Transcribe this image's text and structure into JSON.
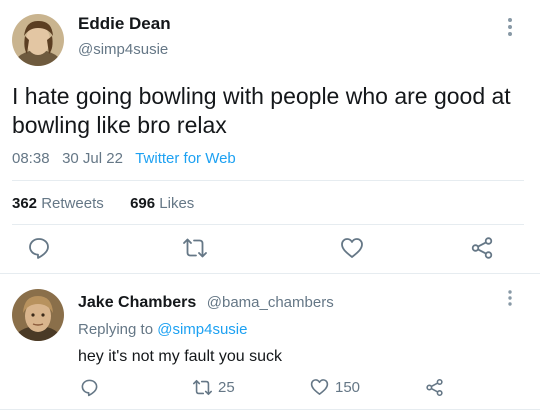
{
  "main_tweet": {
    "author_name": "Eddie Dean",
    "author_handle": "@simp4susie",
    "text": "I hate going bowling with people who are good at bowling like bro relax",
    "time": "08:38",
    "date": "30 Jul 22",
    "source": "Twitter for Web",
    "retweets_count": "362",
    "retweets_label": "Retweets",
    "likes_count": "696",
    "likes_label": "Likes",
    "actions": [
      "reply-icon",
      "retweet-icon",
      "like-icon",
      "share-icon"
    ]
  },
  "reply_tweet": {
    "author_name": "Jake Chambers",
    "author_handle": "@bama_chambers",
    "replying_prefix": "Replying to",
    "replying_to": "@simp4susie",
    "text": "hey it's not my fault you suck",
    "retweets_count": "25",
    "likes_count": "150"
  },
  "colors": {
    "text": "#14171a",
    "muted": "#657786",
    "link": "#1da1f2",
    "icon": "#657786",
    "divider": "#e6ecf0"
  }
}
